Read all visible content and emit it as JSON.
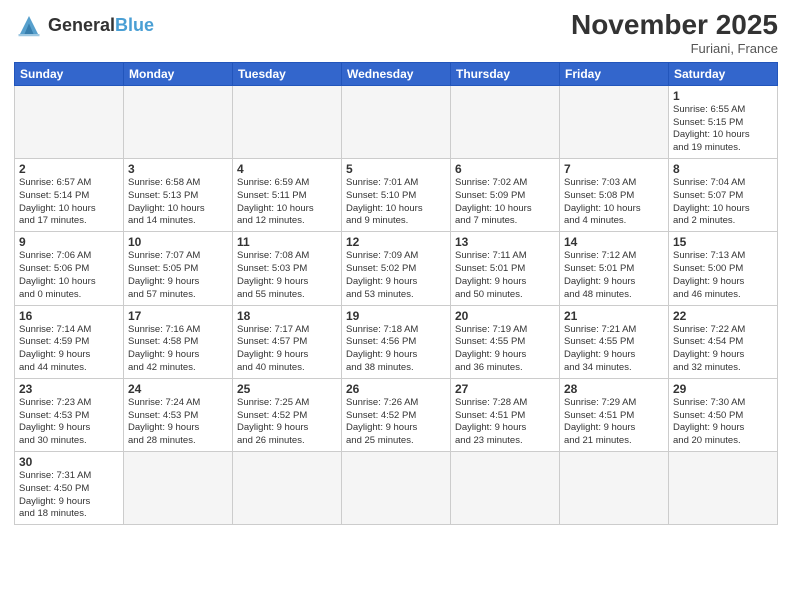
{
  "header": {
    "logo_general": "General",
    "logo_blue": "Blue",
    "month_title": "November 2025",
    "location": "Furiani, France"
  },
  "weekdays": [
    "Sunday",
    "Monday",
    "Tuesday",
    "Wednesday",
    "Thursday",
    "Friday",
    "Saturday"
  ],
  "weeks": [
    [
      {
        "day": "",
        "info": ""
      },
      {
        "day": "",
        "info": ""
      },
      {
        "day": "",
        "info": ""
      },
      {
        "day": "",
        "info": ""
      },
      {
        "day": "",
        "info": ""
      },
      {
        "day": "",
        "info": ""
      },
      {
        "day": "1",
        "info": "Sunrise: 6:55 AM\nSunset: 5:15 PM\nDaylight: 10 hours\nand 19 minutes."
      }
    ],
    [
      {
        "day": "2",
        "info": "Sunrise: 6:57 AM\nSunset: 5:14 PM\nDaylight: 10 hours\nand 17 minutes."
      },
      {
        "day": "3",
        "info": "Sunrise: 6:58 AM\nSunset: 5:13 PM\nDaylight: 10 hours\nand 14 minutes."
      },
      {
        "day": "4",
        "info": "Sunrise: 6:59 AM\nSunset: 5:11 PM\nDaylight: 10 hours\nand 12 minutes."
      },
      {
        "day": "5",
        "info": "Sunrise: 7:01 AM\nSunset: 5:10 PM\nDaylight: 10 hours\nand 9 minutes."
      },
      {
        "day": "6",
        "info": "Sunrise: 7:02 AM\nSunset: 5:09 PM\nDaylight: 10 hours\nand 7 minutes."
      },
      {
        "day": "7",
        "info": "Sunrise: 7:03 AM\nSunset: 5:08 PM\nDaylight: 10 hours\nand 4 minutes."
      },
      {
        "day": "8",
        "info": "Sunrise: 7:04 AM\nSunset: 5:07 PM\nDaylight: 10 hours\nand 2 minutes."
      }
    ],
    [
      {
        "day": "9",
        "info": "Sunrise: 7:06 AM\nSunset: 5:06 PM\nDaylight: 10 hours\nand 0 minutes."
      },
      {
        "day": "10",
        "info": "Sunrise: 7:07 AM\nSunset: 5:05 PM\nDaylight: 9 hours\nand 57 minutes."
      },
      {
        "day": "11",
        "info": "Sunrise: 7:08 AM\nSunset: 5:03 PM\nDaylight: 9 hours\nand 55 minutes."
      },
      {
        "day": "12",
        "info": "Sunrise: 7:09 AM\nSunset: 5:02 PM\nDaylight: 9 hours\nand 53 minutes."
      },
      {
        "day": "13",
        "info": "Sunrise: 7:11 AM\nSunset: 5:01 PM\nDaylight: 9 hours\nand 50 minutes."
      },
      {
        "day": "14",
        "info": "Sunrise: 7:12 AM\nSunset: 5:01 PM\nDaylight: 9 hours\nand 48 minutes."
      },
      {
        "day": "15",
        "info": "Sunrise: 7:13 AM\nSunset: 5:00 PM\nDaylight: 9 hours\nand 46 minutes."
      }
    ],
    [
      {
        "day": "16",
        "info": "Sunrise: 7:14 AM\nSunset: 4:59 PM\nDaylight: 9 hours\nand 44 minutes."
      },
      {
        "day": "17",
        "info": "Sunrise: 7:16 AM\nSunset: 4:58 PM\nDaylight: 9 hours\nand 42 minutes."
      },
      {
        "day": "18",
        "info": "Sunrise: 7:17 AM\nSunset: 4:57 PM\nDaylight: 9 hours\nand 40 minutes."
      },
      {
        "day": "19",
        "info": "Sunrise: 7:18 AM\nSunset: 4:56 PM\nDaylight: 9 hours\nand 38 minutes."
      },
      {
        "day": "20",
        "info": "Sunrise: 7:19 AM\nSunset: 4:55 PM\nDaylight: 9 hours\nand 36 minutes."
      },
      {
        "day": "21",
        "info": "Sunrise: 7:21 AM\nSunset: 4:55 PM\nDaylight: 9 hours\nand 34 minutes."
      },
      {
        "day": "22",
        "info": "Sunrise: 7:22 AM\nSunset: 4:54 PM\nDaylight: 9 hours\nand 32 minutes."
      }
    ],
    [
      {
        "day": "23",
        "info": "Sunrise: 7:23 AM\nSunset: 4:53 PM\nDaylight: 9 hours\nand 30 minutes."
      },
      {
        "day": "24",
        "info": "Sunrise: 7:24 AM\nSunset: 4:53 PM\nDaylight: 9 hours\nand 28 minutes."
      },
      {
        "day": "25",
        "info": "Sunrise: 7:25 AM\nSunset: 4:52 PM\nDaylight: 9 hours\nand 26 minutes."
      },
      {
        "day": "26",
        "info": "Sunrise: 7:26 AM\nSunset: 4:52 PM\nDaylight: 9 hours\nand 25 minutes."
      },
      {
        "day": "27",
        "info": "Sunrise: 7:28 AM\nSunset: 4:51 PM\nDaylight: 9 hours\nand 23 minutes."
      },
      {
        "day": "28",
        "info": "Sunrise: 7:29 AM\nSunset: 4:51 PM\nDaylight: 9 hours\nand 21 minutes."
      },
      {
        "day": "29",
        "info": "Sunrise: 7:30 AM\nSunset: 4:50 PM\nDaylight: 9 hours\nand 20 minutes."
      }
    ],
    [
      {
        "day": "30",
        "info": "Sunrise: 7:31 AM\nSunset: 4:50 PM\nDaylight: 9 hours\nand 18 minutes."
      },
      {
        "day": "",
        "info": ""
      },
      {
        "day": "",
        "info": ""
      },
      {
        "day": "",
        "info": ""
      },
      {
        "day": "",
        "info": ""
      },
      {
        "day": "",
        "info": ""
      },
      {
        "day": "",
        "info": ""
      }
    ]
  ]
}
